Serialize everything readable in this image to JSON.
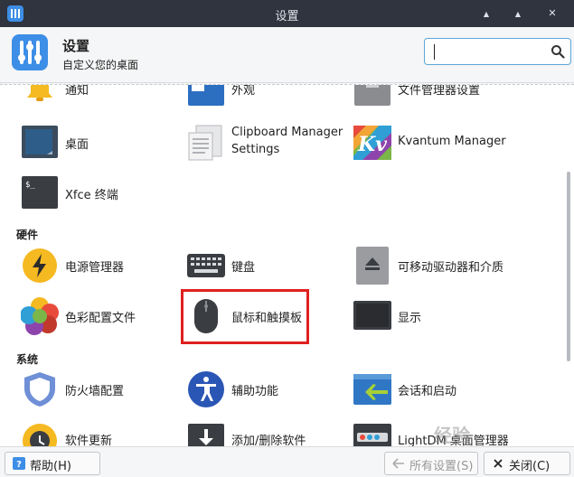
{
  "window": {
    "title": "设置",
    "minimize_glyph": "▲",
    "maximize_glyph": "▲",
    "close_glyph": "✕"
  },
  "header": {
    "title": "设置",
    "subtitle": "自定义您的桌面",
    "search": {
      "value": "",
      "placeholder": ""
    }
  },
  "sections": {
    "top": {
      "items": [
        {
          "label": "通知",
          "icon": "bell-icon"
        },
        {
          "label": "外观",
          "icon": "appearance-icon"
        },
        {
          "label": "文件管理器设置",
          "icon": "file-manager-icon"
        },
        {
          "label": "桌面",
          "icon": "desktop-icon"
        },
        {
          "label": "Clipboard Manager Settings",
          "icon": "clipboard-icon"
        },
        {
          "label": "Kvantum Manager",
          "icon": "kvantum-icon"
        },
        {
          "label": "Xfce 终端",
          "icon": "terminal-icon"
        }
      ]
    },
    "hardware": {
      "title": "硬件",
      "items": [
        {
          "label": "电源管理器",
          "icon": "power-icon"
        },
        {
          "label": "键盘",
          "icon": "keyboard-icon"
        },
        {
          "label": "可移动驱动器和介质",
          "icon": "removable-drive-icon"
        },
        {
          "label": "色彩配置文件",
          "icon": "color-profile-icon"
        },
        {
          "label": "鼠标和触摸板",
          "icon": "mouse-icon"
        },
        {
          "label": "显示",
          "icon": "display-icon"
        }
      ]
    },
    "system": {
      "title": "系统",
      "items": [
        {
          "label": "防火墙配置",
          "icon": "firewall-icon"
        },
        {
          "label": "辅助功能",
          "icon": "accessibility-icon"
        },
        {
          "label": "会话和启动",
          "icon": "session-icon"
        },
        {
          "label": "软件更新",
          "icon": "software-update-icon"
        },
        {
          "label": "添加/删除软件",
          "icon": "add-remove-software-icon"
        },
        {
          "label": "LightDM 桌面管理器",
          "icon": "lightdm-icon"
        }
      ]
    }
  },
  "footer": {
    "help_label": "帮助(H)",
    "all_settings_label": "所有设置(S)",
    "close_label": "关闭(C)"
  },
  "watermark": "经验"
}
